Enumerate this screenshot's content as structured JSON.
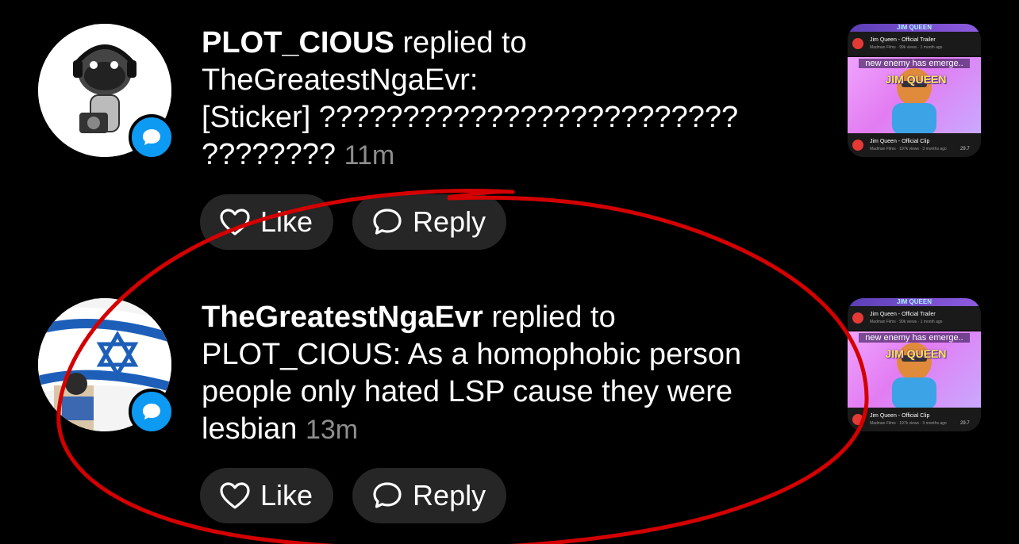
{
  "notifications": [
    {
      "username": "PLOT_CIOUS",
      "action": "replied to",
      "body_line1": "TheGreatestNgaEvr:",
      "body_line2": "[Sticker] ?????????????????????????",
      "body_line3": "????????",
      "time": "11m",
      "like_label": "Like",
      "reply_label": "Reply",
      "thumbnail": {
        "banner": "JIM QUEEN",
        "top_title": "Jim Queen - Official Trailer",
        "top_meta": "Madman Films · 99k views · 1 month ago",
        "overlay_caption": "new enemy has emerge..",
        "overlay_logo": "JIM QUEEN",
        "bottom_title": "Jim Queen - Official Clip",
        "bottom_meta": "Madman Films · 197k views · 3 months ago",
        "bottom_count": "29.7"
      }
    },
    {
      "username": "TheGreatestNgaEvr",
      "action": "replied to",
      "body_line1": "PLOT_CIOUS: As a homophobic person",
      "body_line2": "people only hated LSP cause they were",
      "body_line3": "lesbian",
      "time": "13m",
      "like_label": "Like",
      "reply_label": "Reply",
      "thumbnail": {
        "banner": "JIM QUEEN",
        "top_title": "Jim Queen - Official Trailer",
        "top_meta": "Madman Films · 99k views · 1 month ago",
        "overlay_caption": "new enemy has emerge..",
        "overlay_logo": "JIM QUEEN",
        "bottom_title": "Jim Queen - Official Clip",
        "bottom_meta": "Madman Films · 197k views · 3 months ago",
        "bottom_count": "29.7"
      }
    }
  ],
  "colors": {
    "background": "#000000",
    "pill": "#262626",
    "badge": "#0d9af2",
    "time": "#8e8e8e",
    "annotation": "#d40000"
  },
  "icons": [
    "heart-icon",
    "comment-bubble-icon",
    "chat-bubble-badge-icon"
  ]
}
